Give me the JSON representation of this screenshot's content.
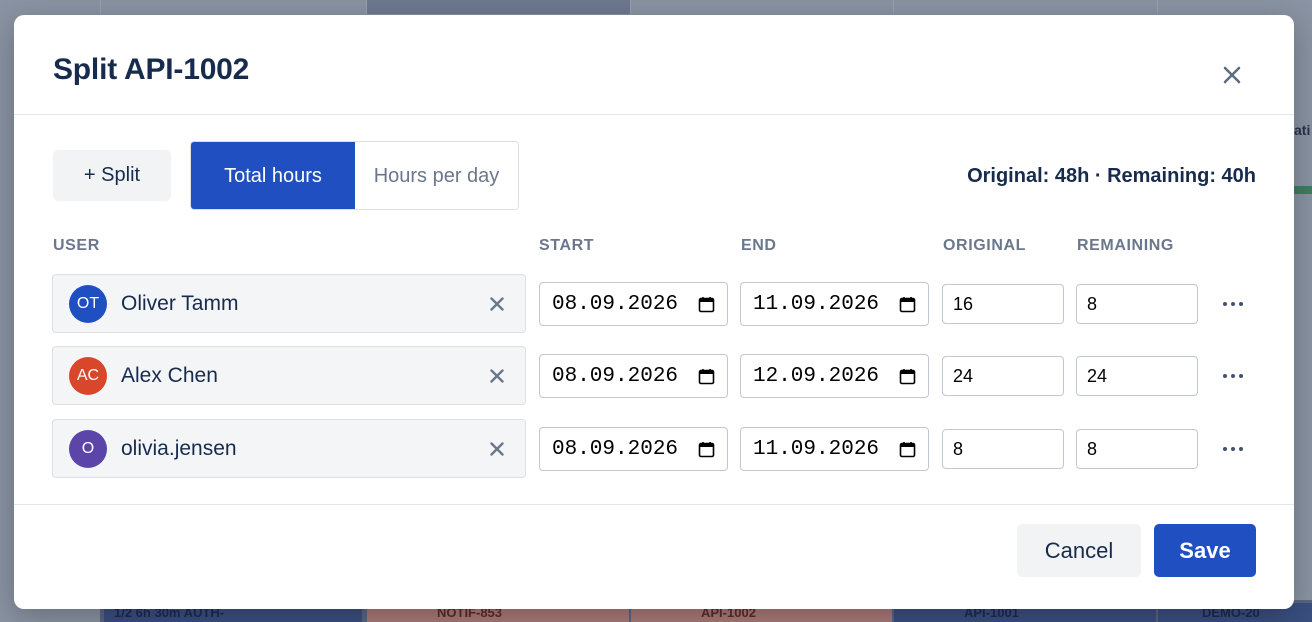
{
  "background": {
    "chips": [
      {
        "label": "1/2   6h 30m   AUTH-",
        "tone": "blue"
      },
      {
        "label": "NOTIF-853",
        "tone": "red"
      },
      {
        "label": "API-1002",
        "tone": "red"
      },
      {
        "label": "API-1001",
        "tone": "blue"
      },
      {
        "label": "DEMO-20",
        "tone": "blue"
      }
    ],
    "fragment": "ati"
  },
  "modal": {
    "title": "Split API-1002",
    "close_icon": "close-icon"
  },
  "toolbar": {
    "split_label": "+ Split",
    "modes": [
      {
        "label": "Total hours",
        "selected": true
      },
      {
        "label": "Hours per day",
        "selected": false
      }
    ],
    "summary": "Original: 48h · Remaining: 40h"
  },
  "columns": {
    "user": "USER",
    "start": "START",
    "end": "END",
    "original": "ORIGINAL",
    "remaining": "REMAINING"
  },
  "rows": [
    {
      "initials": "OT",
      "avatar_color": "#1f4fc1",
      "name": "Oliver Tamm",
      "start": "08.09.2026",
      "end": "11.09.2026",
      "original": "16",
      "remaining": "8"
    },
    {
      "initials": "AC",
      "avatar_color": "#d9472b",
      "name": "Alex Chen",
      "start": "08.09.2026",
      "end": "12.09.2026",
      "original": "24",
      "remaining": "24"
    },
    {
      "initials": "O",
      "avatar_color": "#5b45a8",
      "name": "olivia.jensen",
      "start": "08.09.2026",
      "end": "11.09.2026",
      "original": "8",
      "remaining": "8"
    }
  ],
  "footer": {
    "cancel_label": "Cancel",
    "save_label": "Save"
  },
  "colors": {
    "primary": "#1f4fc1",
    "text": "#172b4d",
    "muted": "#6b778c"
  }
}
